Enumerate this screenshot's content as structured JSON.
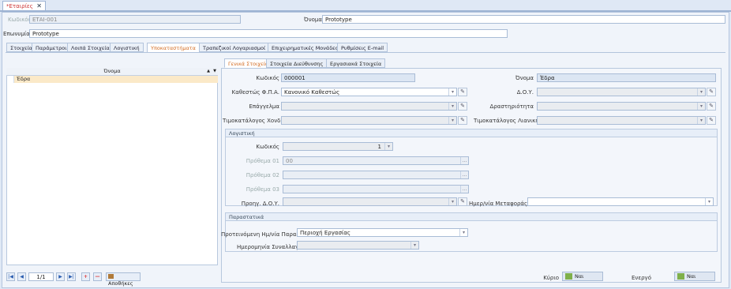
{
  "doc_tab": {
    "title": "*Εταιρίες",
    "close": "✕"
  },
  "header": {
    "code_label": "Κωδικός",
    "code_value": "ΕΤΑΙ-001",
    "name_label": "Όνομα",
    "name_value": "Prototype",
    "company_label": "Επωνυμία",
    "company_value": "Prototype"
  },
  "tabs": [
    {
      "label": "Στοιχεία"
    },
    {
      "label": "Παράμετροι"
    },
    {
      "label": "Λοιπά Στοιχεία"
    },
    {
      "label": "Λογιστική"
    },
    {
      "label": "Υποκαταστήματα"
    },
    {
      "label": "Τραπεζικοί Λογαριασμοί"
    },
    {
      "label": "Επιχειρηματικές Μονάδες"
    },
    {
      "label": "Ρυθμίσεις E-mail"
    }
  ],
  "grid": {
    "column": "Όνομα",
    "sort_icon": "▲",
    "filter_icon": "▼",
    "rows": [
      "Έδρα"
    ]
  },
  "nav": {
    "first": "|◀",
    "prev": "◀",
    "page": "1/1",
    "next": "▶",
    "last": "▶|",
    "add": "+",
    "remove": "—",
    "warehouses": "Αποθήκες"
  },
  "subtabs": [
    {
      "label": "Γενικά Στοιχεία"
    },
    {
      "label": "Στοιχεία Διεύθυνσης"
    },
    {
      "label": "Εργασιακά Στοιχεία"
    }
  ],
  "general": {
    "code_label": "Κωδικός",
    "code_value": "000001",
    "name_label": "Όνομα",
    "name_value": "Έδρα",
    "vat_status_label": "Καθεστώς Φ.Π.Α.",
    "vat_status_value": "Κανονικό Καθεστώς",
    "doy_label": "Δ.Ο.Υ.",
    "profession_label": "Επάγγελμα",
    "activity_label": "Δραστηριότητα",
    "wholesale_label": "Τιμοκατάλογος Χονδρικής",
    "retail_label": "Τιμοκατάλογος Λιανικής"
  },
  "accounting": {
    "title": "Λογιστική",
    "code_label": "Κωδικός",
    "code_value": "1",
    "prefix1_label": "Πρόθεμα 01",
    "prefix1_value": "00",
    "prefix2_label": "Πρόθεμα 02",
    "prefix3_label": "Πρόθεμα 03",
    "prev_doy_label": "Προηγ. Δ.Ο.Υ.",
    "transfer_date_label": "Ημερ/νία Μεταφοράς"
  },
  "documents": {
    "title": "Παραστατικά",
    "suggested_label": "Προτεινόμενη Ημ/νία Παραστατικών",
    "suggested_value": "Περιοχή Εργασίας",
    "trans_date_label": "Ημερομηνία Συναλλαγών"
  },
  "footer": {
    "main_label": "Κύριο",
    "main_value": "Ναι",
    "active_label": "Ενεργό",
    "active_value": "Ναι"
  }
}
